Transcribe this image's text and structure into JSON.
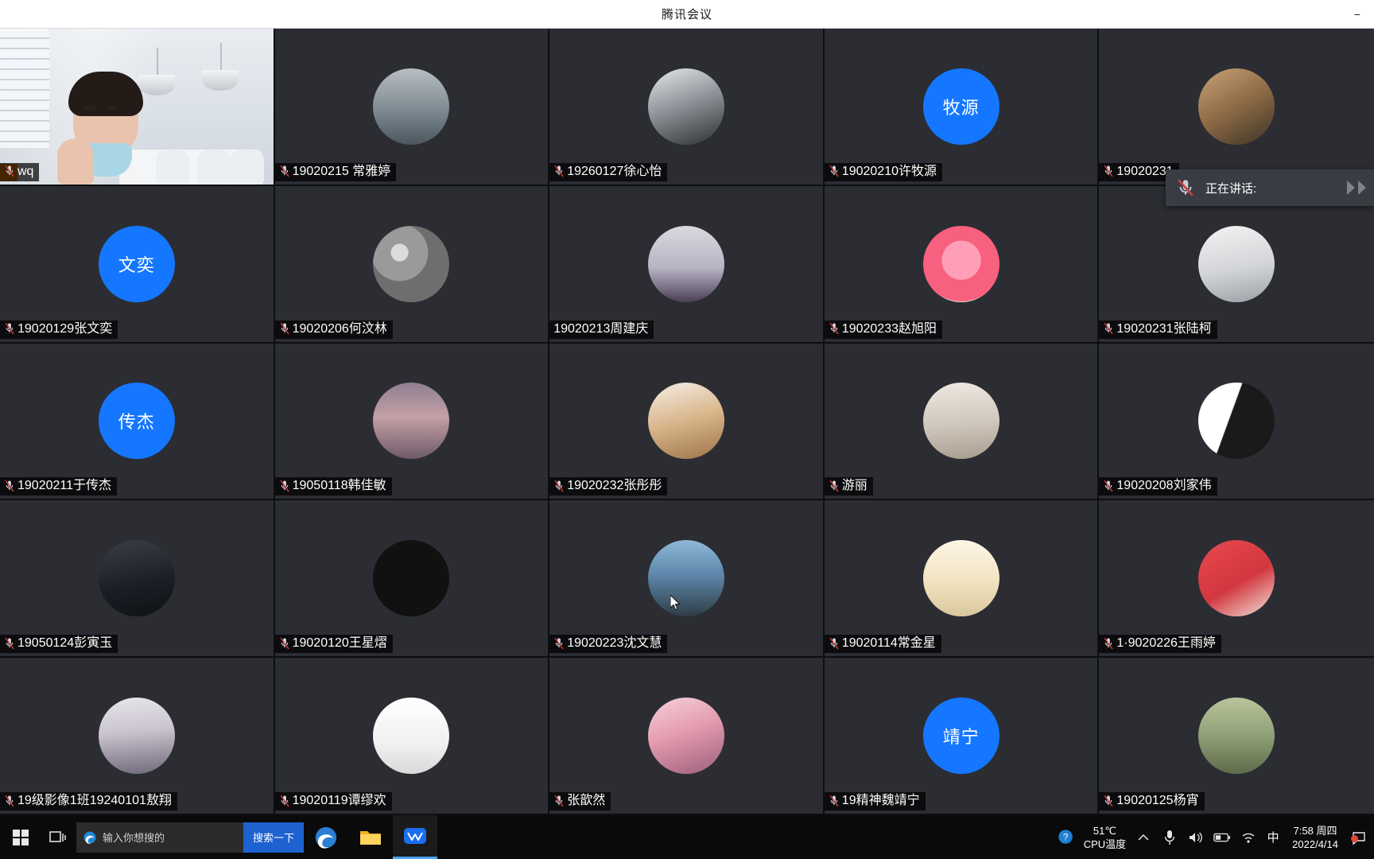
{
  "window": {
    "title": "腾讯会议",
    "controls": [
      "−",
      "□",
      "✕"
    ]
  },
  "speaking_tooltip": {
    "label": "正在讲话:",
    "icon": "mic-muted-icon"
  },
  "grid": {
    "rows": 5,
    "cols": 5,
    "participants": [
      {
        "name": "wq",
        "muted": true,
        "kind": "video",
        "self": true
      },
      {
        "name": "19020215 常雅婷",
        "muted": true,
        "kind": "photo",
        "photo": "hanfu-person"
      },
      {
        "name": "19260127徐心怡",
        "muted": true,
        "kind": "photo",
        "photo": "dark-room"
      },
      {
        "name": "19020210许牧源",
        "muted": true,
        "kind": "initials",
        "initials": "牧源",
        "color": "#1577ff"
      },
      {
        "name": "19020231",
        "muted": true,
        "kind": "photo",
        "photo": "shiba-dog"
      },
      {
        "name": "19020129张文奕",
        "muted": true,
        "kind": "initials",
        "initials": "文奕",
        "color": "#1577ff"
      },
      {
        "name": "19020206何汶林",
        "muted": true,
        "kind": "photo",
        "photo": "gray-stones"
      },
      {
        "name": "19020213周建庆",
        "muted": false,
        "kind": "photo",
        "photo": "anime-boy"
      },
      {
        "name": "19020233赵旭阳",
        "muted": true,
        "kind": "photo",
        "photo": "pink-flower"
      },
      {
        "name": "19020231张陆柯",
        "muted": true,
        "kind": "photo",
        "photo": "husky-meme"
      },
      {
        "name": "19020211于传杰",
        "muted": true,
        "kind": "initials",
        "initials": "传杰",
        "color": "#1577ff"
      },
      {
        "name": "19050118韩佳敏",
        "muted": true,
        "kind": "photo",
        "photo": "girl-hat"
      },
      {
        "name": "19020232张彤彤",
        "muted": true,
        "kind": "photo",
        "photo": "pom-dog"
      },
      {
        "name": "游丽",
        "muted": true,
        "kind": "photo",
        "photo": "white-cat"
      },
      {
        "name": "19020208刘家伟",
        "muted": true,
        "kind": "photo",
        "photo": "manga-bw"
      },
      {
        "name": "19050124彭寅玉",
        "muted": true,
        "kind": "photo",
        "photo": "dark-portrait"
      },
      {
        "name": "19020120王星熠",
        "muted": true,
        "kind": "photo",
        "photo": "text-black"
      },
      {
        "name": "19020223沈文慧",
        "muted": true,
        "kind": "photo",
        "photo": "sea-person"
      },
      {
        "name": "19020114常金星",
        "muted": true,
        "kind": "photo",
        "photo": "blond-anime"
      },
      {
        "name": "1·9020226王雨婷",
        "muted": true,
        "kind": "photo",
        "photo": "red-cartoon"
      },
      {
        "name": "19级影像1班19240101敖翔",
        "muted": true,
        "kind": "photo",
        "photo": "white-haired"
      },
      {
        "name": "19020119谭缪欢",
        "muted": true,
        "kind": "photo",
        "photo": "cup-white"
      },
      {
        "name": "张歆然",
        "muted": true,
        "kind": "photo",
        "photo": "sakura-anime"
      },
      {
        "name": "19精神魏靖宁",
        "muted": true,
        "kind": "initials",
        "initials": "靖宁",
        "color": "#1577ff"
      },
      {
        "name": "19020125杨宵",
        "muted": true,
        "kind": "photo",
        "photo": "field-green"
      }
    ]
  },
  "taskbar": {
    "start_label": "start-button",
    "task_view": "task-view-icon",
    "search": {
      "placeholder": "输入你想搜的",
      "button_label": "搜索一下"
    },
    "apps": [
      "edge-icon",
      "file-explorer-icon",
      "tencent-meeting-icon"
    ],
    "tray": {
      "help_icon": "help-icon",
      "cpu_temp_value": "51℃",
      "cpu_temp_label": "CPU温度",
      "chevron": "chevron-up-icon",
      "mic": "microphone-icon",
      "volume": "volume-icon",
      "battery": "battery-icon",
      "wifi": "wifi-icon",
      "ime": "中",
      "time": "7:58 周四",
      "date": "2022/4/14",
      "action_center": "action-center-icon"
    }
  },
  "colors": {
    "accent": "#1577ff",
    "tile_bg": "#2b2d33",
    "grid_bg": "#17181c",
    "taskbar_bg": "#0a0a0a",
    "search_pill": "#1e62d0"
  }
}
